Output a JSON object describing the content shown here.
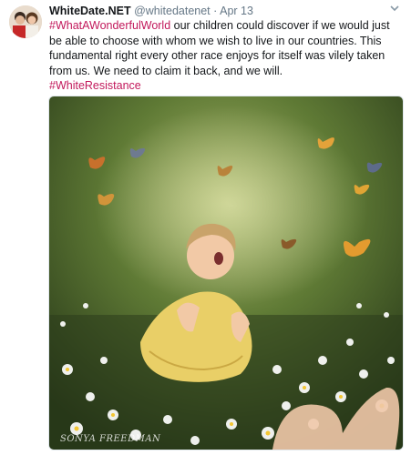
{
  "tweet": {
    "display_name": "WhiteDate.NET",
    "handle": "@whitedatenet",
    "separator": "·",
    "date": "Apr 13",
    "caret_icon": "chevron-down-icon",
    "hashtag_1": "#WhatAWonderfulWorld",
    "text": " our children could discover if we would just be able to choose with whom we wish to live in our countries. This fundamental right every other race enjoys for itself was vilely taken from us. We need to claim it back, and we will.",
    "hashtag_2": "#WhiteResistance"
  },
  "media": {
    "watermark": "SONYA FREEDMAN"
  },
  "colors": {
    "hashtag": "#c2185b",
    "name": "#14171a",
    "meta": "#657786"
  }
}
